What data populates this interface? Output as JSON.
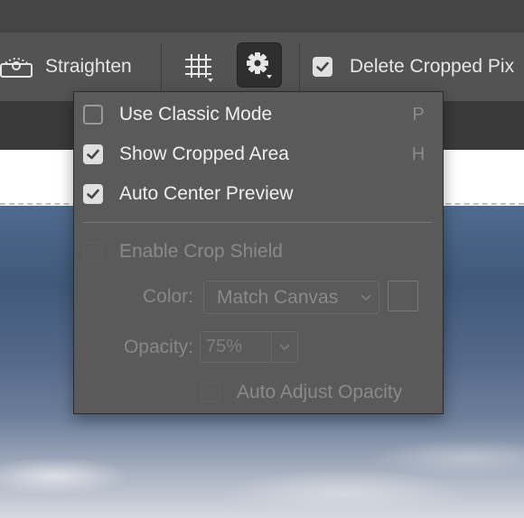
{
  "options_bar": {
    "straighten_label": "Straighten",
    "delete_cropped_label": "Delete Cropped Pix",
    "delete_cropped_checked": true
  },
  "settings_menu": {
    "items": [
      {
        "label": "Use Classic Mode",
        "checked": false,
        "shortcut": "P"
      },
      {
        "label": "Show Cropped Area",
        "checked": true,
        "shortcut": "H"
      },
      {
        "label": "Auto Center Preview",
        "checked": true,
        "shortcut": ""
      }
    ],
    "crop_shield": {
      "label": "Enable Crop Shield",
      "checked": false,
      "color_label": "Color:",
      "color_value": "Match Canvas",
      "opacity_label": "Opacity:",
      "opacity_value": "75%",
      "auto_adjust_label": "Auto Adjust Opacity"
    }
  },
  "icons": [
    "straighten-icon",
    "grid-overlay-icon",
    "gear-icon",
    "checkbox-icon",
    "chevron-down-icon"
  ],
  "colors": {
    "options_bar": "#535353",
    "menu_bg": "#5a5a5a",
    "checkbox_on": "#e0e0e0",
    "canvas": "#ffffff"
  }
}
